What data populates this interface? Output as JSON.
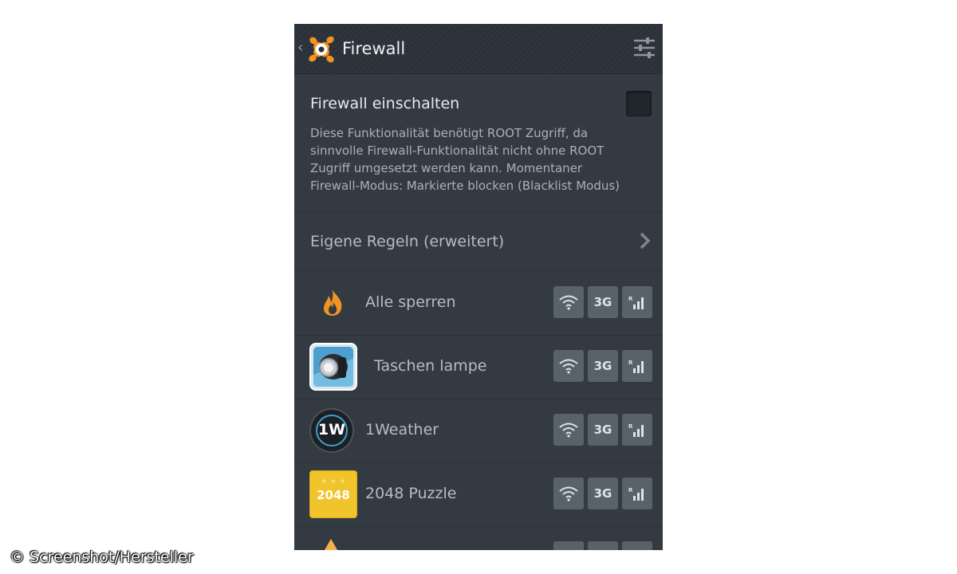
{
  "header": {
    "title": "Firewall",
    "icons": [
      "back-chevron-icon",
      "avast-logo-icon",
      "settings-sliders-icon"
    ]
  },
  "firewall_toggle": {
    "label": "Firewall einschalten",
    "checked": false,
    "description": "Diese Funktionalität benötigt ROOT Zugriff, da\nsinnvolle Firewall-Funktionalität nicht ohne ROOT\nZugriff umgesetzt werden kann. Momentaner\nFirewall-Modus: Markierte blocken (Blacklist Modus)"
  },
  "custom_rules": {
    "label": "Eigene Regeln (erweitert)"
  },
  "apps": [
    {
      "name": "Alle sperren",
      "icon": "flame-icon"
    },
    {
      "name": "Taschen lampe",
      "icon": "flashlight-app-icon"
    },
    {
      "name": "1Weather",
      "icon": "weather-app-icon",
      "icon_text": "1W"
    },
    {
      "name": "2048 Puzzle",
      "icon": "puzzle-2048-app-icon",
      "icon_text": "2048"
    }
  ],
  "network_buttons": {
    "wifi": "wifi-icon",
    "mobile_label": "3G",
    "cellular": "cellular-signal-icon"
  },
  "watermark": "© Screenshot/Hersteller",
  "colors": {
    "background": "#333a42",
    "topbar": "#2b3138",
    "accent_orange": "#f29422",
    "button_bg": "#59616a"
  }
}
